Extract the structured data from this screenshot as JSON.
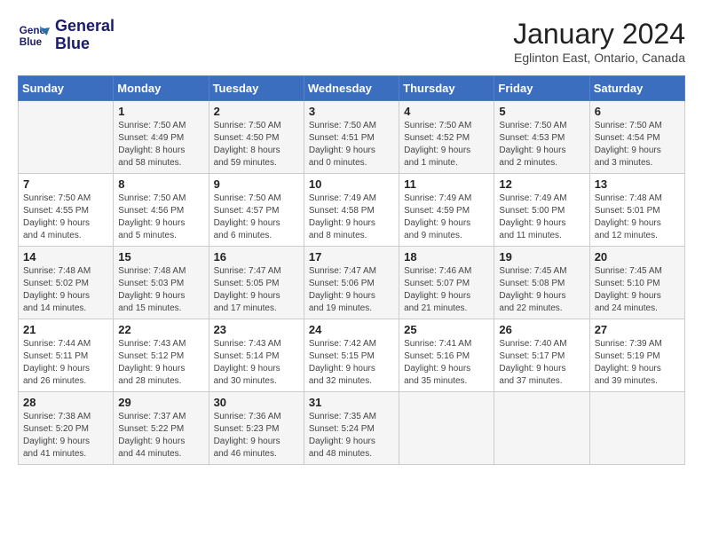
{
  "header": {
    "logo_line1": "General",
    "logo_line2": "Blue",
    "title": "January 2024",
    "subtitle": "Eglinton East, Ontario, Canada"
  },
  "weekdays": [
    "Sunday",
    "Monday",
    "Tuesday",
    "Wednesday",
    "Thursday",
    "Friday",
    "Saturday"
  ],
  "weeks": [
    [
      {
        "day": "",
        "info": ""
      },
      {
        "day": "1",
        "info": "Sunrise: 7:50 AM\nSunset: 4:49 PM\nDaylight: 8 hours\nand 58 minutes."
      },
      {
        "day": "2",
        "info": "Sunrise: 7:50 AM\nSunset: 4:50 PM\nDaylight: 8 hours\nand 59 minutes."
      },
      {
        "day": "3",
        "info": "Sunrise: 7:50 AM\nSunset: 4:51 PM\nDaylight: 9 hours\nand 0 minutes."
      },
      {
        "day": "4",
        "info": "Sunrise: 7:50 AM\nSunset: 4:52 PM\nDaylight: 9 hours\nand 1 minute."
      },
      {
        "day": "5",
        "info": "Sunrise: 7:50 AM\nSunset: 4:53 PM\nDaylight: 9 hours\nand 2 minutes."
      },
      {
        "day": "6",
        "info": "Sunrise: 7:50 AM\nSunset: 4:54 PM\nDaylight: 9 hours\nand 3 minutes."
      }
    ],
    [
      {
        "day": "7",
        "info": "Sunrise: 7:50 AM\nSunset: 4:55 PM\nDaylight: 9 hours\nand 4 minutes."
      },
      {
        "day": "8",
        "info": "Sunrise: 7:50 AM\nSunset: 4:56 PM\nDaylight: 9 hours\nand 5 minutes."
      },
      {
        "day": "9",
        "info": "Sunrise: 7:50 AM\nSunset: 4:57 PM\nDaylight: 9 hours\nand 6 minutes."
      },
      {
        "day": "10",
        "info": "Sunrise: 7:49 AM\nSunset: 4:58 PM\nDaylight: 9 hours\nand 8 minutes."
      },
      {
        "day": "11",
        "info": "Sunrise: 7:49 AM\nSunset: 4:59 PM\nDaylight: 9 hours\nand 9 minutes."
      },
      {
        "day": "12",
        "info": "Sunrise: 7:49 AM\nSunset: 5:00 PM\nDaylight: 9 hours\nand 11 minutes."
      },
      {
        "day": "13",
        "info": "Sunrise: 7:48 AM\nSunset: 5:01 PM\nDaylight: 9 hours\nand 12 minutes."
      }
    ],
    [
      {
        "day": "14",
        "info": "Sunrise: 7:48 AM\nSunset: 5:02 PM\nDaylight: 9 hours\nand 14 minutes."
      },
      {
        "day": "15",
        "info": "Sunrise: 7:48 AM\nSunset: 5:03 PM\nDaylight: 9 hours\nand 15 minutes."
      },
      {
        "day": "16",
        "info": "Sunrise: 7:47 AM\nSunset: 5:05 PM\nDaylight: 9 hours\nand 17 minutes."
      },
      {
        "day": "17",
        "info": "Sunrise: 7:47 AM\nSunset: 5:06 PM\nDaylight: 9 hours\nand 19 minutes."
      },
      {
        "day": "18",
        "info": "Sunrise: 7:46 AM\nSunset: 5:07 PM\nDaylight: 9 hours\nand 21 minutes."
      },
      {
        "day": "19",
        "info": "Sunrise: 7:45 AM\nSunset: 5:08 PM\nDaylight: 9 hours\nand 22 minutes."
      },
      {
        "day": "20",
        "info": "Sunrise: 7:45 AM\nSunset: 5:10 PM\nDaylight: 9 hours\nand 24 minutes."
      }
    ],
    [
      {
        "day": "21",
        "info": "Sunrise: 7:44 AM\nSunset: 5:11 PM\nDaylight: 9 hours\nand 26 minutes."
      },
      {
        "day": "22",
        "info": "Sunrise: 7:43 AM\nSunset: 5:12 PM\nDaylight: 9 hours\nand 28 minutes."
      },
      {
        "day": "23",
        "info": "Sunrise: 7:43 AM\nSunset: 5:14 PM\nDaylight: 9 hours\nand 30 minutes."
      },
      {
        "day": "24",
        "info": "Sunrise: 7:42 AM\nSunset: 5:15 PM\nDaylight: 9 hours\nand 32 minutes."
      },
      {
        "day": "25",
        "info": "Sunrise: 7:41 AM\nSunset: 5:16 PM\nDaylight: 9 hours\nand 35 minutes."
      },
      {
        "day": "26",
        "info": "Sunrise: 7:40 AM\nSunset: 5:17 PM\nDaylight: 9 hours\nand 37 minutes."
      },
      {
        "day": "27",
        "info": "Sunrise: 7:39 AM\nSunset: 5:19 PM\nDaylight: 9 hours\nand 39 minutes."
      }
    ],
    [
      {
        "day": "28",
        "info": "Sunrise: 7:38 AM\nSunset: 5:20 PM\nDaylight: 9 hours\nand 41 minutes."
      },
      {
        "day": "29",
        "info": "Sunrise: 7:37 AM\nSunset: 5:22 PM\nDaylight: 9 hours\nand 44 minutes."
      },
      {
        "day": "30",
        "info": "Sunrise: 7:36 AM\nSunset: 5:23 PM\nDaylight: 9 hours\nand 46 minutes."
      },
      {
        "day": "31",
        "info": "Sunrise: 7:35 AM\nSunset: 5:24 PM\nDaylight: 9 hours\nand 48 minutes."
      },
      {
        "day": "",
        "info": ""
      },
      {
        "day": "",
        "info": ""
      },
      {
        "day": "",
        "info": ""
      }
    ]
  ]
}
